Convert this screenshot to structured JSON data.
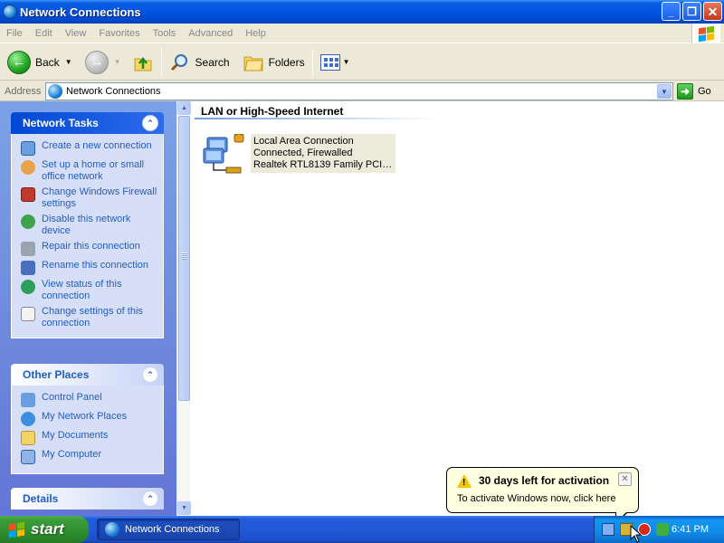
{
  "window": {
    "title": "Network Connections",
    "buttons": {
      "minimize": "_",
      "maximize": "❐",
      "close": "✕"
    }
  },
  "menu": [
    "File",
    "Edit",
    "View",
    "Favorites",
    "Tools",
    "Advanced",
    "Help"
  ],
  "toolbar": {
    "back_label": "Back",
    "search_label": "Search",
    "folders_label": "Folders"
  },
  "address": {
    "label": "Address",
    "value": "Network Connections",
    "go_label": "Go"
  },
  "sidebar": {
    "network_tasks": {
      "title": "Network Tasks",
      "items": [
        {
          "label": "Create a new connection",
          "icon": "new-connection-icon"
        },
        {
          "label": "Set up a home or small office network",
          "icon": "home-network-icon"
        },
        {
          "label": "Change Windows Firewall settings",
          "icon": "firewall-icon"
        },
        {
          "label": "Disable this network device",
          "icon": "disable-device-icon"
        },
        {
          "label": "Repair this connection",
          "icon": "repair-icon"
        },
        {
          "label": "Rename this connection",
          "icon": "rename-icon"
        },
        {
          "label": "View status of this connection",
          "icon": "status-icon"
        },
        {
          "label": "Change settings of this connection",
          "icon": "settings-icon"
        }
      ]
    },
    "other_places": {
      "title": "Other Places",
      "items": [
        {
          "label": "Control Panel",
          "icon": "control-panel-icon"
        },
        {
          "label": "My Network Places",
          "icon": "network-places-icon"
        },
        {
          "label": "My Documents",
          "icon": "documents-icon"
        },
        {
          "label": "My Computer",
          "icon": "computer-icon"
        }
      ]
    },
    "details": {
      "title": "Details"
    }
  },
  "main": {
    "group_title": "LAN or High-Speed Internet",
    "connection": {
      "name": "Local Area Connection",
      "status": "Connected, Firewalled",
      "device": "Realtek RTL8139 Family PCI F..."
    }
  },
  "balloon": {
    "title": "30 days left for activation",
    "text": "To activate Windows now, click here",
    "close": "✕"
  },
  "taskbar": {
    "start_label": "start",
    "task_label": "Network Connections",
    "clock": "6:41 PM"
  },
  "colors": {
    "title_bar": "#0054E3",
    "sidebar_bg": "#7BA2E7",
    "link": "#215DC6",
    "start_green": "#3A9D3A",
    "tray_blue": "#0F8BE8"
  }
}
